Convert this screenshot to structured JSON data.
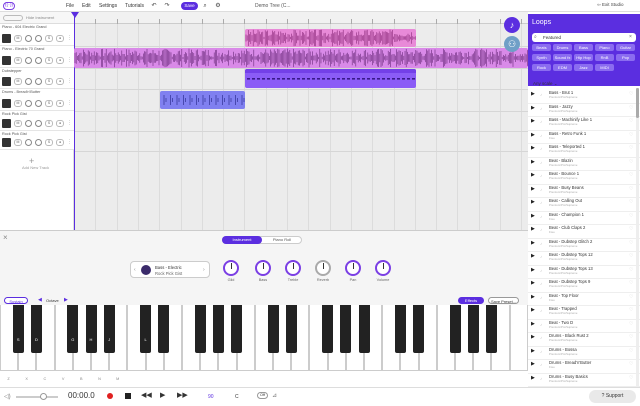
{
  "topbar": {
    "logo": "((·))",
    "menus": [
      "File",
      "Edit",
      "Settings",
      "Tutorials"
    ],
    "save_label": "Save",
    "project_name": "Demo Tree (C...",
    "exit_label": "Exit Studio"
  },
  "tracks_header": {
    "hide_instrument": "Hide Instrument"
  },
  "tracks": [
    {
      "name": "Piano - 604 Electric Grand"
    },
    {
      "name": "Piano - Electric 70 Grand"
    },
    {
      "name": "Dubstepper"
    },
    {
      "name": "Drums - Bread'n'Butter"
    },
    {
      "name": "Rock Pick Gist"
    },
    {
      "name": "Rock Pick Gist"
    }
  ],
  "add_track_label": "Add New Track",
  "instrument_panel": {
    "tabs": [
      "Instrument",
      "Piano Roll"
    ],
    "instrument_name": "Bass - Electric",
    "instrument_sub": "Rock Pick Gist",
    "knobs": [
      "Glid",
      "Bass",
      "Treble",
      "Reverb",
      "Pan",
      "Volume"
    ],
    "sustain_label": "Sustain",
    "octave_label": "Octave",
    "effects_label": "Effects",
    "save_preset_label": "Save Preset..."
  },
  "keyboard": {
    "black_labels": [
      "S",
      "D",
      "G",
      "H",
      "J",
      "L",
      "",
      "",
      "",
      "",
      "",
      ""
    ],
    "white_labels": [
      "Z",
      "X",
      "C",
      "V",
      "B",
      "N",
      "M",
      "",
      "",
      "",
      "",
      "",
      "",
      "",
      "",
      "",
      "",
      "",
      "",
      "",
      "",
      "",
      "",
      "",
      "",
      "",
      "",
      "",
      ""
    ]
  },
  "transport": {
    "time": "00:00.0",
    "bpm": "90",
    "key": "C",
    "loop_toggle": "Off",
    "support_label": "Support"
  },
  "loops_panel": {
    "title": "Loops",
    "search_value": "Featured",
    "chips": [
      [
        "Beats",
        "Drums",
        "Bass",
        "Piano",
        "Guitar"
      ],
      [
        "Synth",
        "Sound fx",
        "Hip Hop",
        "RnB",
        "Pop"
      ],
      [
        "Rock",
        "EDM",
        "Jazz",
        "MIDI"
      ]
    ],
    "scale_label": "Any scale",
    "items": [
      {
        "name": "Bass - Brut 1",
        "sub": "Premium/Pro/Supreme"
      },
      {
        "name": "Bass - Jazzy",
        "sub": "Premium/Pro/Supreme"
      },
      {
        "name": "Bass - Machinify Like 1",
        "sub": "Premium/Pro/Supreme"
      },
      {
        "name": "Bass - Retro Funk 1",
        "sub": "Free"
      },
      {
        "name": "Bass - Teleported 1",
        "sub": "Premium/Pro/Supreme"
      },
      {
        "name": "Beat - Blazin",
        "sub": "Premium/Pro/Supreme"
      },
      {
        "name": "Beat - Bounce 1",
        "sub": "Premium/Pro/Supreme"
      },
      {
        "name": "Beat - Busy Beans",
        "sub": "Premium/Pro/Supreme"
      },
      {
        "name": "Beat - Calling Out",
        "sub": "Premium/Pro/Supreme"
      },
      {
        "name": "Beat - Champion 1",
        "sub": "Free"
      },
      {
        "name": "Beat - Club Claps 2",
        "sub": "Free"
      },
      {
        "name": "Beat - Dubstep Glitch 2",
        "sub": "Premium/Pro/Supreme"
      },
      {
        "name": "Beat - Dubstep Tops 12",
        "sub": "Premium/Pro/Supreme"
      },
      {
        "name": "Beat - Dubstep Tops 13",
        "sub": "Premium/Pro/Supreme"
      },
      {
        "name": "Beat - Dubstep Tops 9",
        "sub": "Premium/Pro/Supreme"
      },
      {
        "name": "Beat - Top Floor",
        "sub": "Free"
      },
      {
        "name": "Beat - Trapped",
        "sub": "Premium/Pro/Supreme"
      },
      {
        "name": "Beat - Two D",
        "sub": "Premium/Pro/Supreme"
      },
      {
        "name": "Drums - Black Rust 2",
        "sub": "Premium/Pro/Supreme"
      },
      {
        "name": "Drums - Bossa",
        "sub": "Premium/Pro/Supreme"
      },
      {
        "name": "Drums - Bread'n'Butter",
        "sub": "Free"
      },
      {
        "name": "Drums - Busy Basics",
        "sub": "Premium/Pro/Supreme"
      }
    ]
  },
  "colors": {
    "accent": "#5b2ee0",
    "pink_clip": "#e88ad8",
    "violet_clip": "#8b5cf6",
    "blue_clip": "#8080f0"
  },
  "icons": [
    "logo-icon",
    "undo-icon",
    "redo-icon",
    "search-icon",
    "settings-icon",
    "music-note-icon",
    "people-icon",
    "play-icon",
    "stop-icon",
    "record-icon",
    "rewind-icon",
    "forward-icon",
    "heart-icon"
  ]
}
